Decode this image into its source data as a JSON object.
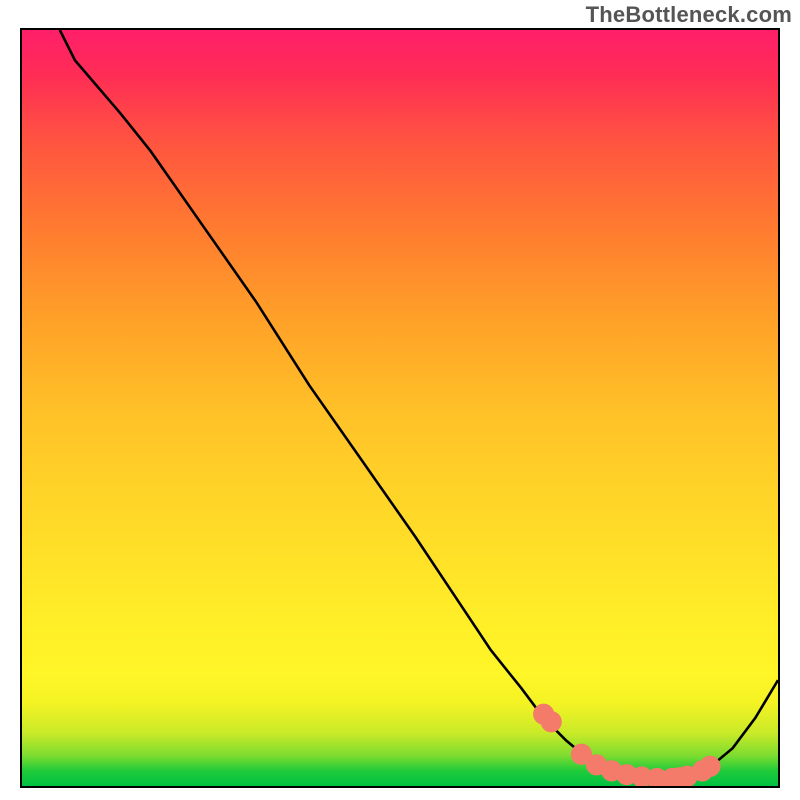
{
  "watermark": "TheBottleneck.com",
  "colors": {
    "curve": "#000000",
    "dot": "#f47b6a",
    "border": "#000000"
  },
  "chart_data": {
    "type": "line",
    "title": "",
    "xlabel": "",
    "ylabel": "",
    "xlim": [
      0,
      100
    ],
    "ylim": [
      0,
      100
    ],
    "grid": false,
    "series": [
      {
        "name": "curve",
        "x": [
          5,
          7,
          13,
          17,
          24,
          31,
          38,
          45,
          52,
          58,
          62,
          66,
          69,
          72,
          75,
          78,
          81,
          84,
          86,
          88,
          91,
          94,
          97,
          100
        ],
        "y": [
          100,
          96,
          89,
          84,
          74,
          64,
          53,
          43,
          33,
          24,
          18,
          13,
          9,
          6,
          3.5,
          2,
          1.2,
          1,
          1,
          1.3,
          2.5,
          5,
          9,
          14
        ]
      }
    ],
    "markers": {
      "name": "dots",
      "x": [
        69,
        70,
        74,
        76,
        78,
        80,
        82,
        84,
        86,
        87,
        88,
        90,
        91
      ],
      "y": [
        9.5,
        8.5,
        4.2,
        2.8,
        2.0,
        1.5,
        1.2,
        1.0,
        1.0,
        1.1,
        1.3,
        2.0,
        2.6
      ]
    }
  }
}
